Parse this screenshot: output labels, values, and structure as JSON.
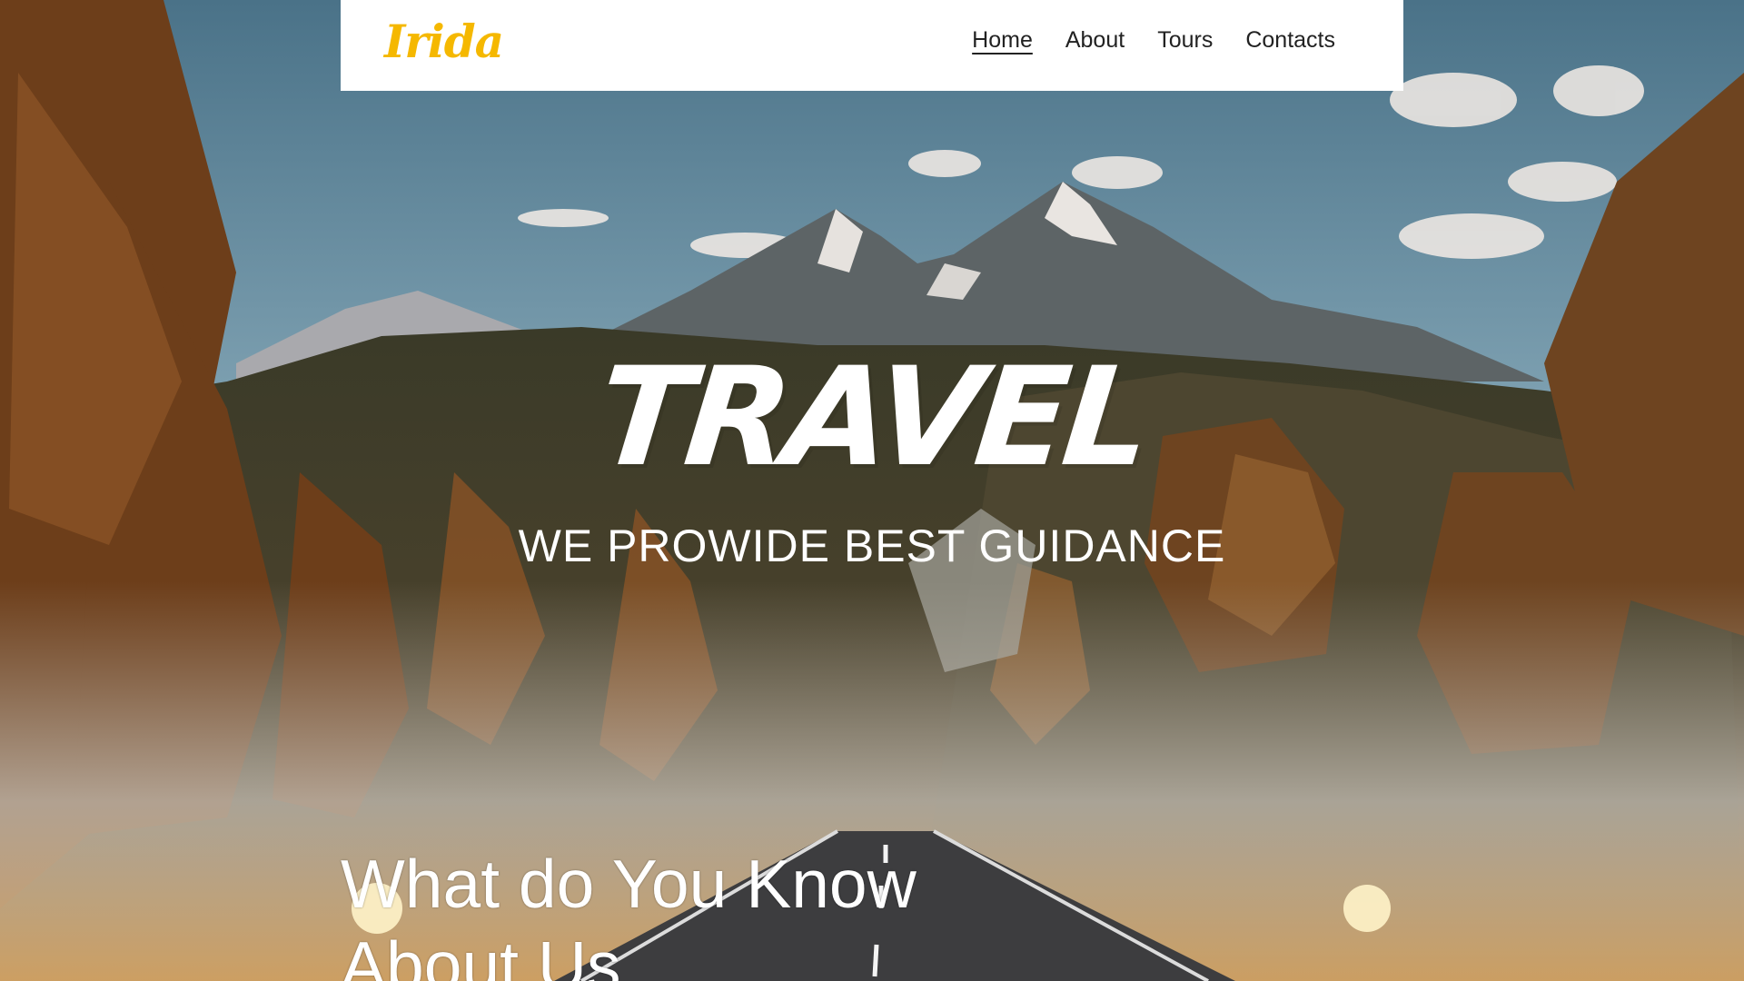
{
  "brand": {
    "logo_text": "Irida",
    "logo_color": "#f5b800"
  },
  "nav": {
    "items": [
      {
        "label": "Home",
        "active": true
      },
      {
        "label": "About",
        "active": false
      },
      {
        "label": "Tours",
        "active": false
      },
      {
        "label": "Contacts",
        "active": false
      }
    ]
  },
  "hero": {
    "title": "TRAVEL",
    "subtitle": "WE PROWIDE BEST GUIDANCE",
    "background_image": "mountain-forest-road-photo"
  },
  "about": {
    "heading_line1": "What do You Know",
    "heading_line2": "About Us"
  }
}
